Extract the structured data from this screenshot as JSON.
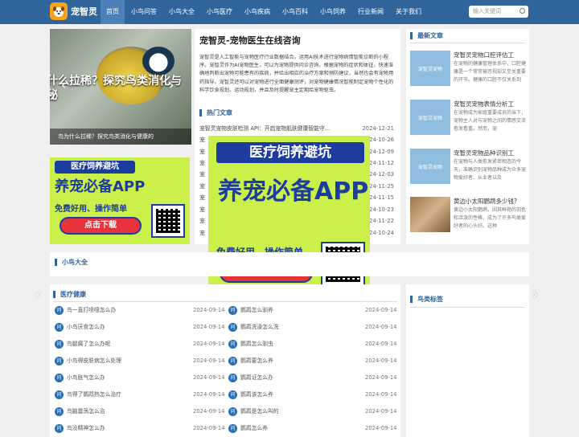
{
  "brand": {
    "name": "宠智灵"
  },
  "nav": [
    "首页",
    "小鸟问答",
    "小鸟大全",
    "小鸟医疗",
    "小鸟疾病",
    "小鸟百科",
    "小鸟饲养",
    "行业新闻",
    "关于我们"
  ],
  "search": {
    "placeholder": "输入关键词"
  },
  "slider": {
    "overlay_line1": "什么拉稀？探究鸟类消化与",
    "overlay_line2": "秘",
    "caption": "鸟为什么拉稀？探究鸟类消化与健康的"
  },
  "intro": {
    "title": "宠智灵-宠物医生在线咨询",
    "text": "宠智灵是人工智能与宠物医疗行业数据结合，运用AI技术进行宠物病情智能诊断的小程序。宠智灵作为AI宠物医生，可以为宠物提供问诊咨询，根据宠物的症状和体征，快速准确地判断出宠物可能患有的疾病，并给出相应的治疗方案和预防建议，当然也会有宠物用药指导。宠智灵还可以对宠物进行全面健康测评，对宠物健康情况智能制定宠物个性化的科学饮食规划、运动规划，并且及时提醒宠主定期给宠物驱虫。"
  },
  "hot": {
    "title": "热门文章",
    "items": [
      {
        "t": "宠智灵宠物皮肤检测 API：开启宠物肌肤健康智能守...",
        "d": "2024-12-21"
      },
      {
        "t": "宠",
        "d": "2024-10-26"
      },
      {
        "t": "宠",
        "d": "2024-12-09"
      },
      {
        "t": "宠",
        "d": "2024-11-12"
      },
      {
        "t": "宠",
        "d": "2024-12-03"
      },
      {
        "t": "宠",
        "d": "2024-11-25"
      },
      {
        "t": "宠",
        "d": "2024-11-15"
      },
      {
        "t": "宠",
        "d": "2024-10-23"
      },
      {
        "t": "宠",
        "d": "2024-11-22"
      },
      {
        "t": "宠",
        "d": "2024-10-24"
      }
    ]
  },
  "ad": {
    "line1": "医疗饲养避坑",
    "line2": "养宠必备APP",
    "line3": "免费好用、操作简单",
    "button": "点击下载"
  },
  "news": {
    "title": "最新文章",
    "items": [
      {
        "title": "宠智灵宠物口腔评估工",
        "desc": "在宠物的健康管理体系中，口腔健康是一个常常被忽视却又至关重要的环节。健康的口腔不仅关系到",
        "thumb": "宠智灵宠物"
      },
      {
        "title": "宠智灵宠物表情分析工",
        "desc": "在宠物成为家庭重要成员的当下，宠物主人对与宠物之间的情感交流愈发看重。然而，宠",
        "thumb": "宠智灵宠物"
      },
      {
        "title": "宠智灵宠物品种识别工",
        "desc": "在宠物与人类愈发紧密相连的今天，准确识别宠物品种成为众多宠物爱好者、从业者以及",
        "thumb": "宠智灵宠物"
      },
      {
        "title": "黄边小太阳鹦鹉多少钱?",
        "desc": "黄边小太阳鹦鹉，因其鲜艳的羽色和活泼的性格，成为了许多鸟类爱好者的心头好。这种",
        "thumb": ""
      }
    ]
  },
  "bird_section": {
    "title": "小鸟大全"
  },
  "health": {
    "title": "医疗健康",
    "left": [
      {
        "t": "鸟一直打喷嚏怎么办",
        "d": "2024-09-14"
      },
      {
        "t": "小鸟厌食怎么办",
        "d": "2024-09-14"
      },
      {
        "t": "鸟腿瘸了怎么办呢",
        "d": "2024-09-14"
      },
      {
        "t": "小鸟得皮肤病怎么处理",
        "d": "2024-09-14"
      },
      {
        "t": "小鸟胀气怎么办",
        "d": "2024-09-14"
      },
      {
        "t": "鸟得了鹦鹉热怎么治疗",
        "d": "2024-09-14"
      },
      {
        "t": "鸟脑震荡怎么治",
        "d": "2024-09-14"
      },
      {
        "t": "鸟没精神怎么办",
        "d": "2024-09-14"
      }
    ],
    "right": [
      {
        "t": "鹦鹉怎么驯养",
        "d": "2024-09-14"
      },
      {
        "t": "鹦鹉洗澡怎么洗",
        "d": "2024-09-14"
      },
      {
        "t": "鹦鹉怎么驯虫",
        "d": "2024-09-14"
      },
      {
        "t": "鹦鹉要怎么养",
        "d": "2024-09-14"
      },
      {
        "t": "鹦鹉证怎么办",
        "d": "2024-09-14"
      },
      {
        "t": "鹦鹉该怎么养",
        "d": "2024-09-14"
      },
      {
        "t": "鹦鹉是怎么叫的",
        "d": "2024-09-14"
      },
      {
        "t": "鹦鹉怎么养",
        "d": "2024-09-14"
      }
    ]
  },
  "tags": {
    "title": "鸟类标签"
  },
  "colors": {
    "nav": "#30659c",
    "accent": "#2a6fb0",
    "ad_bg": "#ccf04a",
    "ad_blue": "#1d3ca0",
    "ad_red": "#e8333b"
  }
}
